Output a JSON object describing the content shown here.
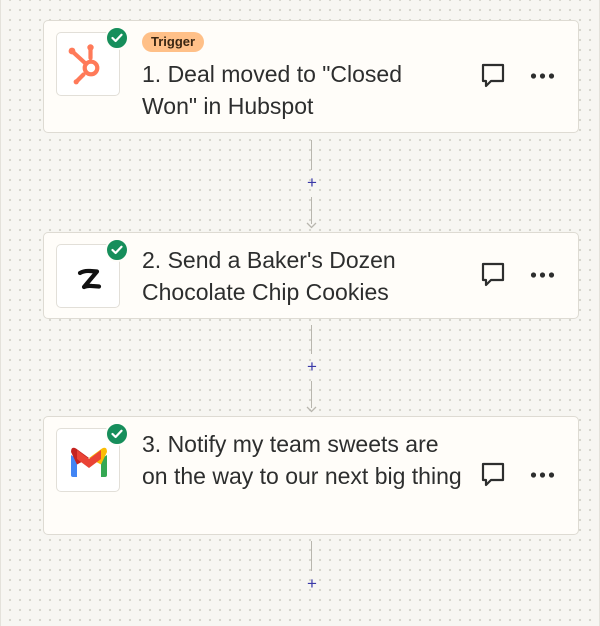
{
  "steps": [
    {
      "number": "1",
      "badge": "Trigger",
      "title": "1. Deal moved to \"Closed Won\" in Hubspot",
      "app_icon": "hubspot-icon",
      "status": "completed",
      "status_icon": "check-icon"
    },
    {
      "number": "2",
      "title": "2. Send a Baker's Dozen Chocolate Chip Cookies",
      "app_icon": "zapier-z-icon",
      "status": "completed",
      "status_icon": "check-icon"
    },
    {
      "number": "3",
      "title": "3. Notify my team sweets are on the way to our next big thing",
      "app_icon": "gmail-icon",
      "status": "completed",
      "status_icon": "check-icon"
    }
  ],
  "actions": {
    "comment_icon": "comment-icon",
    "more_icon": "more-options-icon",
    "add_step_label": "+"
  },
  "colors": {
    "check_green": "#168e5b",
    "trigger_badge_bg": "#ffc088",
    "hubspot_orange": "#ff7a59",
    "add_step_blue": "#3a39a8",
    "canvas_bg": "#f7f6f2"
  }
}
